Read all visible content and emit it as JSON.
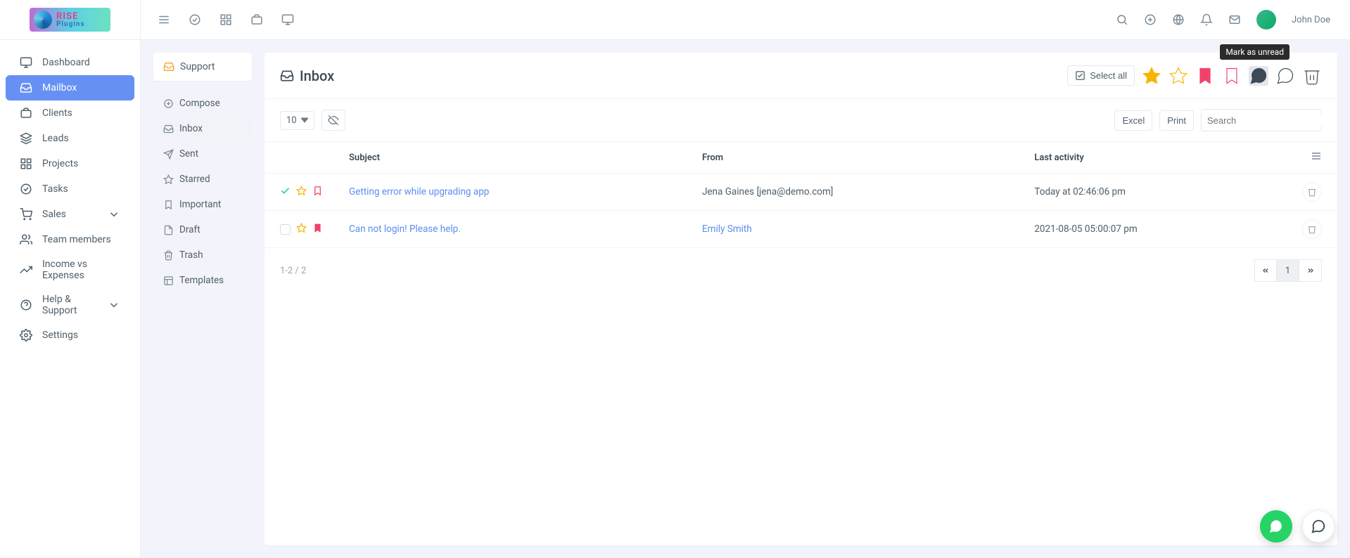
{
  "user": {
    "name": "John Doe"
  },
  "sidebar": {
    "items": [
      {
        "label": "Dashboard"
      },
      {
        "label": "Mailbox"
      },
      {
        "label": "Clients"
      },
      {
        "label": "Leads"
      },
      {
        "label": "Projects"
      },
      {
        "label": "Tasks"
      },
      {
        "label": "Sales"
      },
      {
        "label": "Team members"
      },
      {
        "label": "Income vs Expenses"
      },
      {
        "label": "Help & Support"
      },
      {
        "label": "Settings"
      }
    ]
  },
  "subnav": {
    "support_label": "Support",
    "items": [
      {
        "label": "Compose"
      },
      {
        "label": "Inbox"
      },
      {
        "label": "Sent"
      },
      {
        "label": "Starred"
      },
      {
        "label": "Important"
      },
      {
        "label": "Draft"
      },
      {
        "label": "Trash"
      },
      {
        "label": "Templates"
      }
    ]
  },
  "main": {
    "title": "Inbox",
    "select_all_label": "Select all",
    "tooltip": "Mark as unread",
    "page_size": "10",
    "export": {
      "excel": "Excel",
      "print": "Print"
    },
    "search_placeholder": "Search",
    "columns": {
      "subject": "Subject",
      "from": "From",
      "last_activity": "Last activity"
    },
    "rows": [
      {
        "subject": "Getting error while upgrading app",
        "from": "Jena Gaines [jena@demo.com]",
        "from_is_link": false,
        "last_activity": "Today at 02:46:06 pm"
      },
      {
        "subject": "Can not login! Please help.",
        "from": "Emily Smith",
        "from_is_link": true,
        "last_activity": "2021-08-05 05:00:07 pm"
      }
    ],
    "range": "1-2 / 2",
    "current_page": "1"
  }
}
